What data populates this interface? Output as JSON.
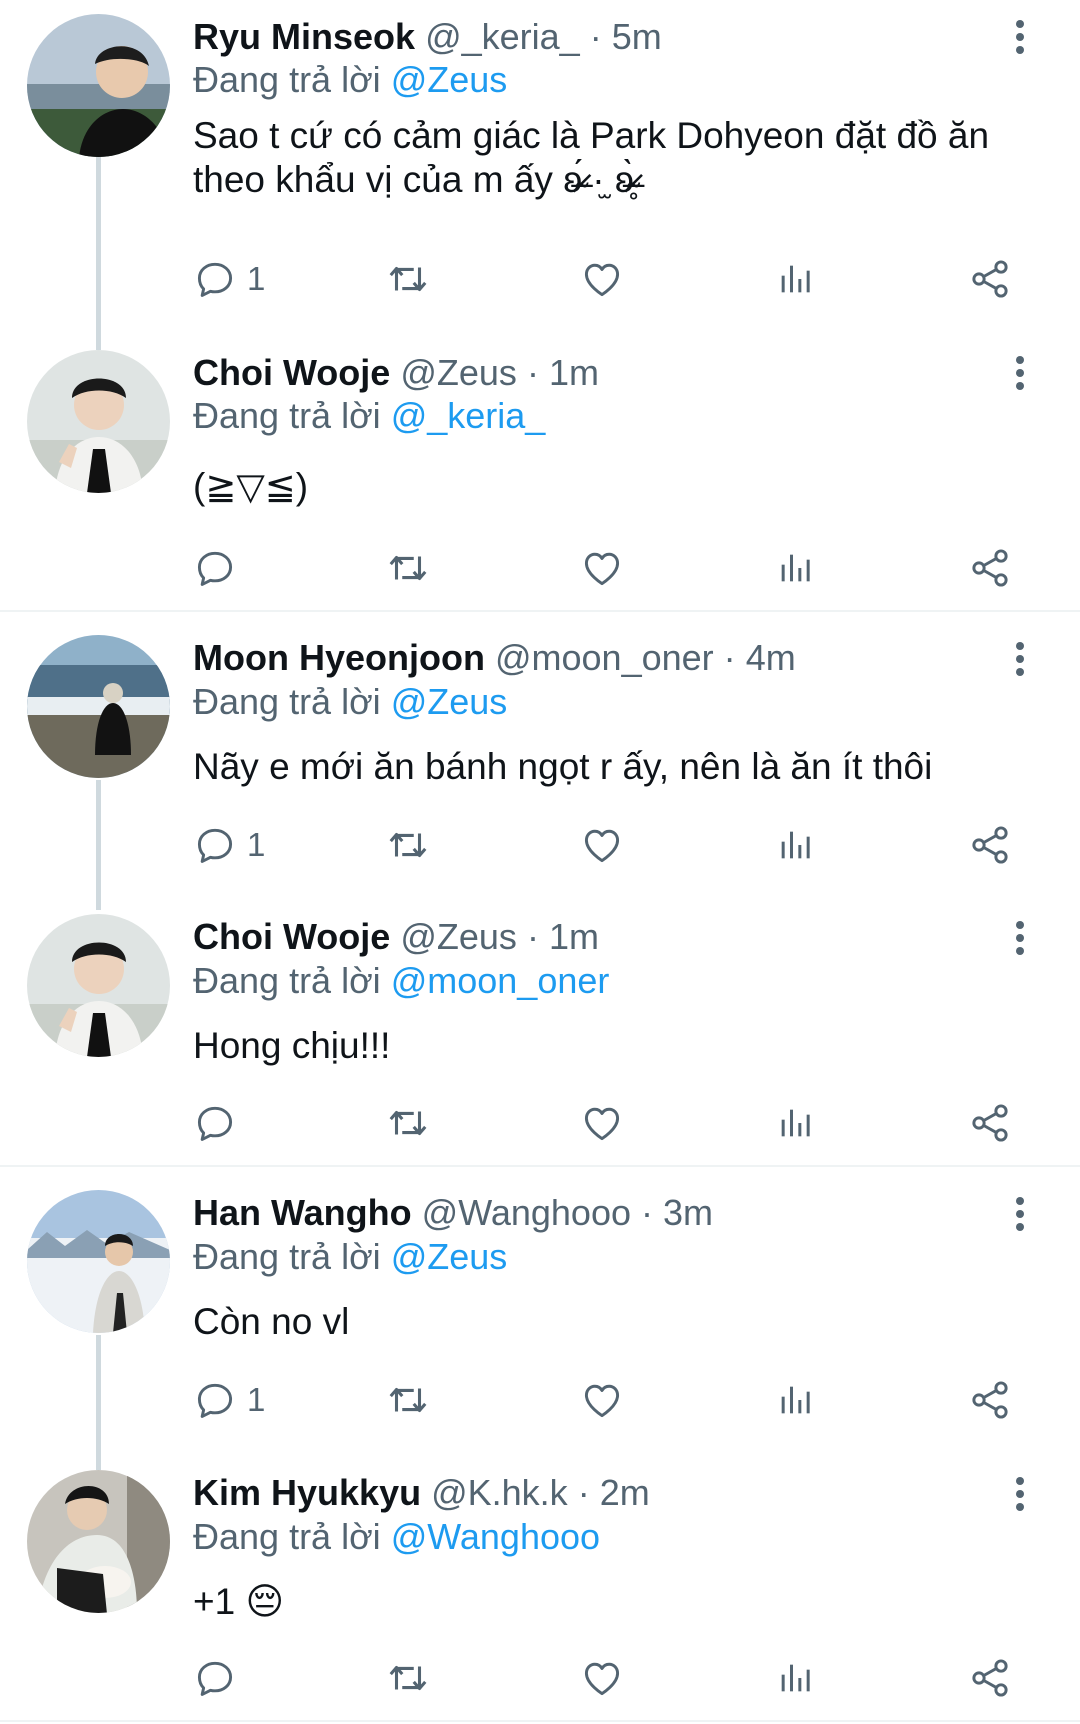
{
  "thread1": {
    "tweet1": {
      "name": "Ryu Minseok",
      "handle": "@_keria_",
      "time": "5m",
      "replying_prefix": "Đang trả lời",
      "replying_to": "@Zeus",
      "text": "Sao t cứ có cảm giác là Park Dohyeon đặt đồ ăn theo khẩu vị của m ấy ʚ̴̶̷́ ·̫ ʚ̴̶̷̥̀",
      "reply_count": "1"
    },
    "tweet2": {
      "name": "Choi Wooje",
      "handle": "@Zeus",
      "time": "1m",
      "replying_prefix": "Đang trả lời",
      "replying_to": "@_keria_",
      "text": "(≧▽≦)",
      "reply_count": ""
    }
  },
  "thread2": {
    "tweet1": {
      "name": "Moon Hyeonjoon",
      "handle": "@moon_oner",
      "time": "4m",
      "replying_prefix": "Đang trả lời",
      "replying_to": "@Zeus",
      "text": "Nãy e mới ăn bánh ngọt r ấy, nên là ăn ít thôi",
      "reply_count": "1"
    },
    "tweet2": {
      "name": "Choi Wooje",
      "handle": "@Zeus",
      "time": "1m",
      "replying_prefix": "Đang trả lời",
      "replying_to": "@moon_oner",
      "text": "Hong chịu!!!",
      "reply_count": ""
    }
  },
  "thread3": {
    "tweet1": {
      "name": "Han Wangho",
      "handle": "@Wanghooo",
      "time": "3m",
      "replying_prefix": "Đang trả lời",
      "replying_to": "@Zeus",
      "text": "Còn no vl",
      "reply_count": "1"
    },
    "tweet2": {
      "name": "Kim Hyukkyu",
      "handle": "@K.hk.k",
      "time": "2m",
      "replying_prefix": "Đang trả lời",
      "replying_to": "@Wanghooo",
      "text": "+1 😔",
      "reply_count": ""
    }
  },
  "separator": "·",
  "icons": {
    "reply": "reply-icon",
    "retweet": "retweet-icon",
    "like": "heart-icon",
    "views": "views-icon",
    "share": "share-icon",
    "more": "more-vertical-icon"
  },
  "colors": {
    "mention": "#1d9bf0",
    "secondary": "#536471",
    "thread_line": "#cfd9de"
  }
}
